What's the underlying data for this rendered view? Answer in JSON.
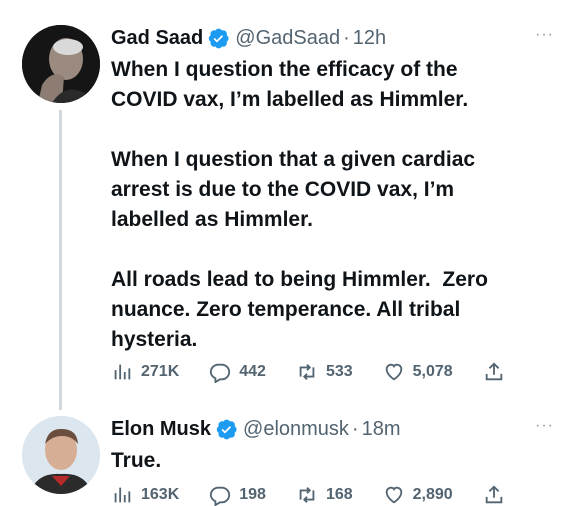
{
  "tweets": [
    {
      "name": "Gad Saad",
      "handle": "@GadSaad",
      "separator": "·",
      "time": "12h",
      "text": "When I question the efficacy of the\nCOVID vax, I’m labelled as Himmler.\n\nWhen I question that a given cardiac\narrest is due to the COVID vax, I’m\nlabelled as Himmler.\n\nAll roads lead to being Himmler.  Zero\nnuance. Zero temperance. All tribal\nhysteria.",
      "views": "271K",
      "replies": "442",
      "retweets": "533",
      "likes": "5,078"
    },
    {
      "name": "Elon Musk",
      "handle": "@elonmusk",
      "separator": "·",
      "time": "18m",
      "text": "True.",
      "views": "163K",
      "replies": "198",
      "retweets": "168",
      "likes": "2,890"
    }
  ],
  "more_label": "···",
  "colors": {
    "verified": "#1d9bf0",
    "secondary_text": "#536471",
    "thread_line": "#cfd9de"
  },
  "icons": [
    "verified-badge-icon",
    "views-icon",
    "reply-icon",
    "retweet-icon",
    "like-icon",
    "share-icon",
    "more-icon"
  ]
}
